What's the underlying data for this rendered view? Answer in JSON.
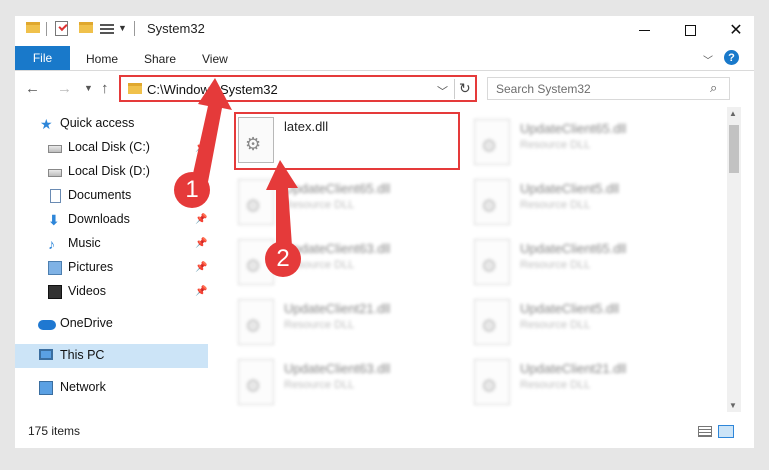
{
  "window": {
    "title": "System32",
    "minimize_glyph": "—",
    "close_glyph": "✕"
  },
  "ribbon": {
    "tabs": [
      {
        "label": "File"
      },
      {
        "label": "Home"
      },
      {
        "label": "Share"
      },
      {
        "label": "View"
      }
    ],
    "help_glyph": "?"
  },
  "address": {
    "path": "C:\\Windows\\System32",
    "search_placeholder": "Search System32"
  },
  "sidebar": {
    "items": [
      {
        "label": "Quick access",
        "icon": "star-icon"
      },
      {
        "label": "Local Disk (C:)",
        "icon": "disk-icon",
        "pinned": true
      },
      {
        "label": "Local Disk (D:)",
        "icon": "disk-icon",
        "pinned": true
      },
      {
        "label": "Documents",
        "icon": "documents-icon",
        "pinned": true
      },
      {
        "label": "Downloads",
        "icon": "downloads-icon",
        "pinned": true
      },
      {
        "label": "Music",
        "icon": "music-icon",
        "pinned": true
      },
      {
        "label": "Pictures",
        "icon": "pictures-icon",
        "pinned": true
      },
      {
        "label": "Videos",
        "icon": "videos-icon",
        "pinned": true
      },
      {
        "label": "OneDrive",
        "icon": "cloud-icon"
      },
      {
        "label": "This PC",
        "icon": "computer-icon",
        "selected": true
      },
      {
        "label": "Network",
        "icon": "network-icon"
      }
    ]
  },
  "files": {
    "col1": [
      {
        "name": "latex.dll",
        "type": ""
      },
      {
        "name": "UpdateClient65.dll",
        "type": "Resource DLL"
      },
      {
        "name": "UpdateClient63.dll",
        "type": "Resource DLL"
      },
      {
        "name": "UpdateClient21.dll",
        "type": "Resource DLL"
      },
      {
        "name": "UpdateClient63.dll",
        "type": "Resource DLL"
      }
    ],
    "col2": [
      {
        "name": "UpdateClient65.dll",
        "type": "Resource DLL"
      },
      {
        "name": "UpdateClient5.dll",
        "type": "Resource DLL"
      },
      {
        "name": "UpdateClient65.dll",
        "type": "Resource DLL"
      },
      {
        "name": "UpdateClient5.dll",
        "type": "Resource DLL"
      },
      {
        "name": "UpdateClient21.dll",
        "type": "Resource DLL"
      }
    ]
  },
  "status": {
    "item_count": "175 items"
  },
  "callouts": {
    "one": "1",
    "two": "2"
  },
  "colors": {
    "accent": "#1979ca",
    "highlight": "#e53a3a",
    "selection": "#cce4f7"
  }
}
